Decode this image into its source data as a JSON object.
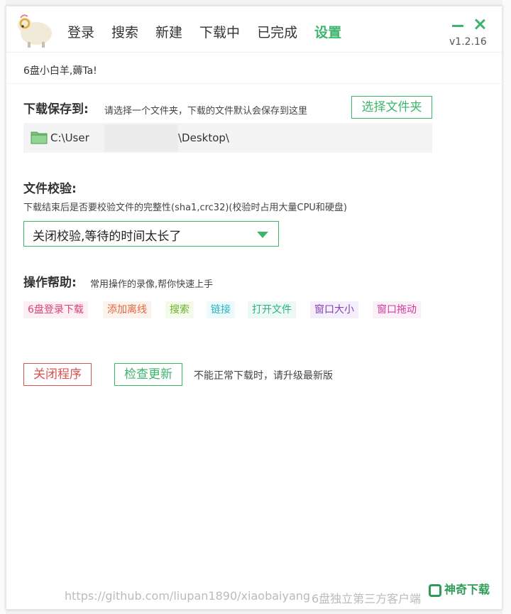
{
  "nav": {
    "items": [
      {
        "label": "登录"
      },
      {
        "label": "搜索"
      },
      {
        "label": "新建"
      },
      {
        "label": "下载中"
      },
      {
        "label": "已完成"
      },
      {
        "label": "设置"
      }
    ],
    "active_index": 5
  },
  "window": {
    "version": "v1.2.16"
  },
  "greeting": "6盘小白羊,薅Ta!",
  "download_location": {
    "title": "下载保存到:",
    "desc": "请选择一个文件夹，下载的文件默认会保存到这里",
    "choose_button": "选择文件夹",
    "path_prefix": "C:\\User",
    "path_suffix": "\\Desktop\\"
  },
  "verification": {
    "title": "文件校验:",
    "desc": "下载结束后是否要校验文件的完整性(sha1,crc32)(校验时占用大量CPU和硬盘)",
    "selected": "关闭校验,等待的时间太长了"
  },
  "help": {
    "title": "操作帮助:",
    "desc": "常用操作的录像,帮你快速上手",
    "tags": [
      {
        "label": "6盘登录下载",
        "color": "#e0407c",
        "bg": "#fdf0f5"
      },
      {
        "label": "添加离线",
        "color": "#e2673a",
        "bg": "#fdf3ee"
      },
      {
        "label": "搜索",
        "color": "#6fb32a",
        "bg": "#f4fbec"
      },
      {
        "label": "链接",
        "color": "#27b3c4",
        "bg": "#edf9fb"
      },
      {
        "label": "打开文件",
        "color": "#2db07f",
        "bg": "#edf9f4"
      },
      {
        "label": "窗口大小",
        "color": "#8240b8",
        "bg": "#f5eefb"
      },
      {
        "label": "窗口拖动",
        "color": "#d23a9c",
        "bg": "#fcf0f8"
      }
    ]
  },
  "actions": {
    "close_program": "关闭程序",
    "check_update": "检查更新",
    "update_hint": "不能正常下载时，请升级最新版"
  },
  "footer": {
    "url": "https://github.com/liupan1890/xiaobaiyang",
    "tagline": "6盘独立第三方客户端"
  },
  "watermark": {
    "text": "神奇下载"
  },
  "colors": {
    "accent": "#3db56d",
    "danger": "#d9534f"
  }
}
